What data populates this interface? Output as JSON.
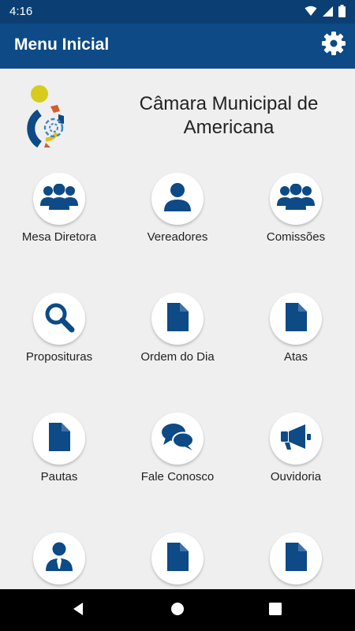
{
  "status_bar": {
    "time": "4:16"
  },
  "app_bar": {
    "title": "Menu Inicial"
  },
  "header": {
    "org_name": "Câmara Municipal de Americana"
  },
  "menu_items": [
    {
      "label": "Mesa Diretora",
      "icon": "group-icon"
    },
    {
      "label": "Vereadores",
      "icon": "person-icon"
    },
    {
      "label": "Comissões",
      "icon": "group-icon"
    },
    {
      "label": "Proposituras",
      "icon": "search-icon"
    },
    {
      "label": "Ordem do Dia",
      "icon": "document-icon"
    },
    {
      "label": "Atas",
      "icon": "document-icon"
    },
    {
      "label": "Pautas",
      "icon": "document-icon"
    },
    {
      "label": "Fale Conosco",
      "icon": "chat-icon"
    },
    {
      "label": "Ouvidoria",
      "icon": "megaphone-icon"
    },
    {
      "label": "",
      "icon": "person-tie-icon"
    },
    {
      "label": "",
      "icon": "document-icon"
    },
    {
      "label": "",
      "icon": "document-icon"
    }
  ],
  "colors": {
    "primary": "#0d4a86",
    "status_bar": "#0b3f73",
    "icon": "#0d4a86",
    "background": "#efefef"
  }
}
